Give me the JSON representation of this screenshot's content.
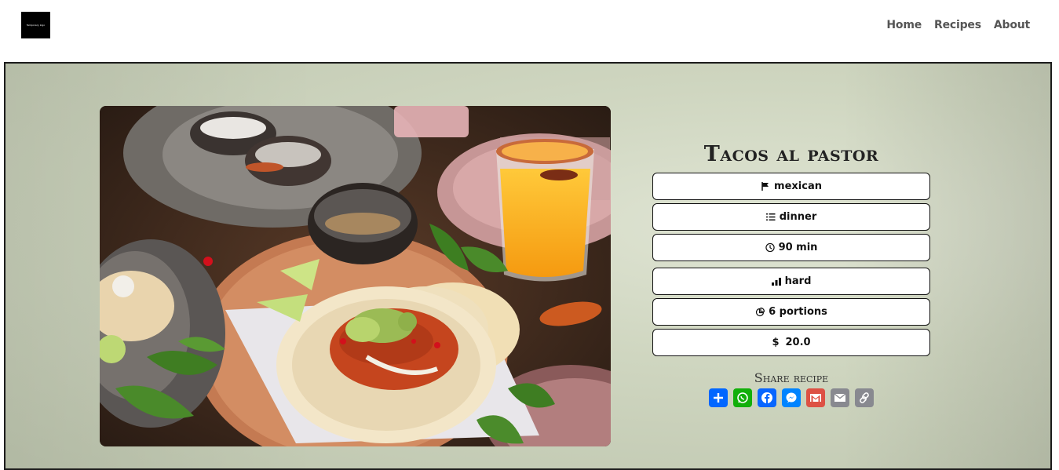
{
  "logo": {
    "text": "Temporary logo"
  },
  "nav": {
    "items": [
      "Home",
      "Recipes",
      "About"
    ]
  },
  "recipe": {
    "title": "Tacos al pastor",
    "cuisine": "mexican",
    "meal": "dinner",
    "time": "90 min",
    "difficulty": "hard",
    "portions": "6 portions",
    "price": "20.0",
    "price_symbol": "$"
  },
  "share": {
    "label": "Share recipe",
    "buttons": [
      {
        "name": "share-add-icon",
        "color": "#0166ff"
      },
      {
        "name": "whatsapp-icon",
        "color": "#12af0a"
      },
      {
        "name": "facebook-icon",
        "color": "#0866ff"
      },
      {
        "name": "messenger-icon",
        "color": "#0084ff"
      },
      {
        "name": "gmail-icon",
        "color": "#dd5144"
      },
      {
        "name": "email-icon",
        "color": "#888990"
      },
      {
        "name": "copy-link-icon",
        "color": "#888990"
      }
    ]
  },
  "colors": {
    "hero_bg": "#cfd6c0",
    "text": "#111111",
    "nav_text": "#555555"
  }
}
